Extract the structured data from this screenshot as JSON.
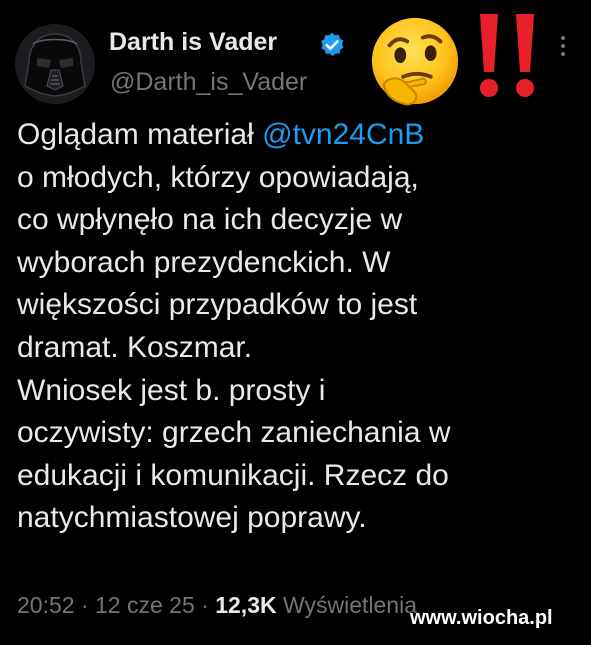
{
  "author": {
    "display_name": "Darth is Vader",
    "handle": "@Darth_is_Vader",
    "verified": true,
    "avatar_icon": "darth-vader-helmet-avatar"
  },
  "header_emojis": [
    "thinking-face-icon",
    "double-exclamation-icon"
  ],
  "more_icon": "more-options-icon",
  "tweet": {
    "lines": [
      {
        "before": "Oglądam materiał ",
        "mention": "@tvn24CnB",
        "after": ""
      },
      {
        "before": "o młodych, którzy opowiadają,",
        "mention": "",
        "after": ""
      },
      {
        "before": "co wpłynęło na ich decyzje w",
        "mention": "",
        "after": ""
      },
      {
        "before": "wyborach prezydenckich. W",
        "mention": "",
        "after": ""
      },
      {
        "before": "większości przypadków to jest",
        "mention": "",
        "after": ""
      },
      {
        "before": "dramat. Koszmar.",
        "mention": "",
        "after": ""
      },
      {
        "before": "Wniosek jest b. prosty i",
        "mention": "",
        "after": ""
      },
      {
        "before": "oczywisty: grzech zaniechania w",
        "mention": "",
        "after": ""
      },
      {
        "before": "edukacji i komunikacji. Rzecz do",
        "mention": "",
        "after": ""
      },
      {
        "before": "natychmiastowej poprawy.",
        "mention": "",
        "after": ""
      }
    ]
  },
  "meta": {
    "time": "20:52",
    "separator1": " · ",
    "date": "12 cze 25",
    "separator2": " · ",
    "views_count": "12,3K",
    "views_label": " Wyświetlenia"
  },
  "watermark": "www.wiocha.pl",
  "colors": {
    "background": "#000000",
    "text": "#e7e9ea",
    "secondary": "#71767b",
    "accent": "#1d9bf0"
  }
}
